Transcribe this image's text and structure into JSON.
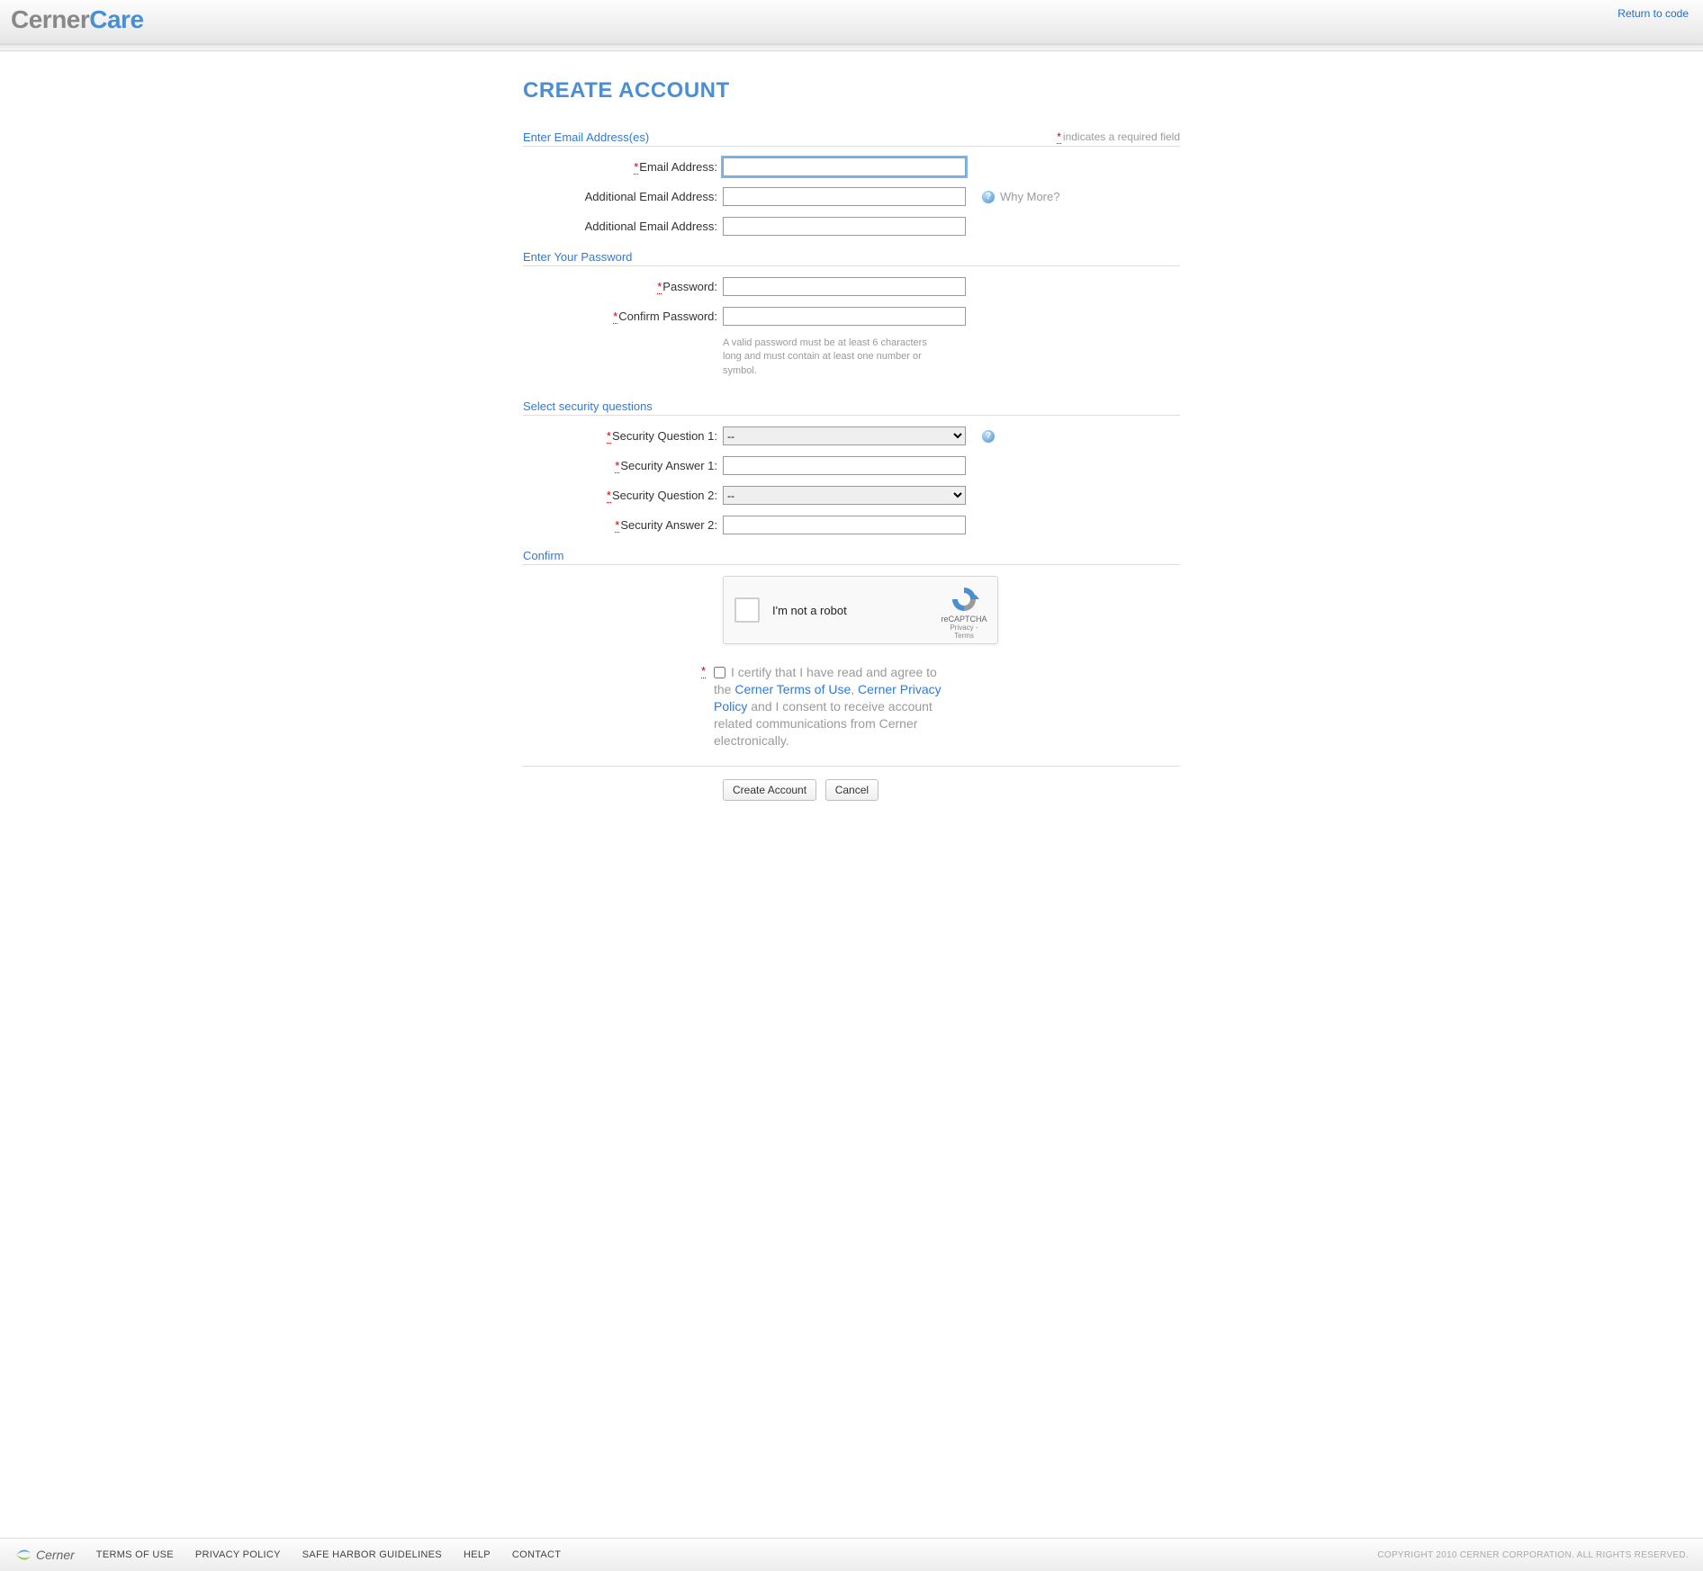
{
  "header": {
    "brand_part1": "Cerner",
    "brand_part2": "Care",
    "return_link": "Return to code"
  },
  "page": {
    "title": "CREATE ACCOUNT"
  },
  "required_note": "indicates a required field",
  "sections": {
    "email": {
      "legend": "Enter Email Address(es)",
      "email_label": "Email Address:",
      "additional_label": "Additional Email Address:",
      "why_more": "Why More?"
    },
    "password": {
      "legend": "Enter Your Password",
      "password_label": "Password:",
      "confirm_label": "Confirm Password:",
      "hint": "A valid password must be at least 6 characters long and must contain at least one number or symbol."
    },
    "security": {
      "legend": "Select security questions",
      "q1_label": "Security Question 1:",
      "a1_label": "Security Answer 1:",
      "q2_label": "Security Question 2:",
      "a2_label": "Security Answer 2:",
      "placeholder": "--"
    },
    "confirm": {
      "legend": "Confirm",
      "captcha_label": "I'm not a robot",
      "captcha_brand": "reCAPTCHA",
      "captcha_sub": "Privacy - Terms",
      "consent_pre": "I certify that I have read and agree to the ",
      "consent_link1": "Cerner Terms of Use",
      "consent_mid": ", ",
      "consent_link2": "Cerner Privacy Policy",
      "consent_post": " and I consent to receive account related communications from Cerner electronically."
    }
  },
  "buttons": {
    "create": "Create Account",
    "cancel": "Cancel"
  },
  "footer": {
    "logo_text": "Cerner",
    "links": [
      "TERMS OF USE",
      "PRIVACY POLICY",
      "SAFE HARBOR GUIDELINES",
      "HELP",
      "CONTACT"
    ],
    "copyright": "COPYRIGHT 2010 CERNER CORPORATION. ALL RIGHTS RESERVED."
  }
}
